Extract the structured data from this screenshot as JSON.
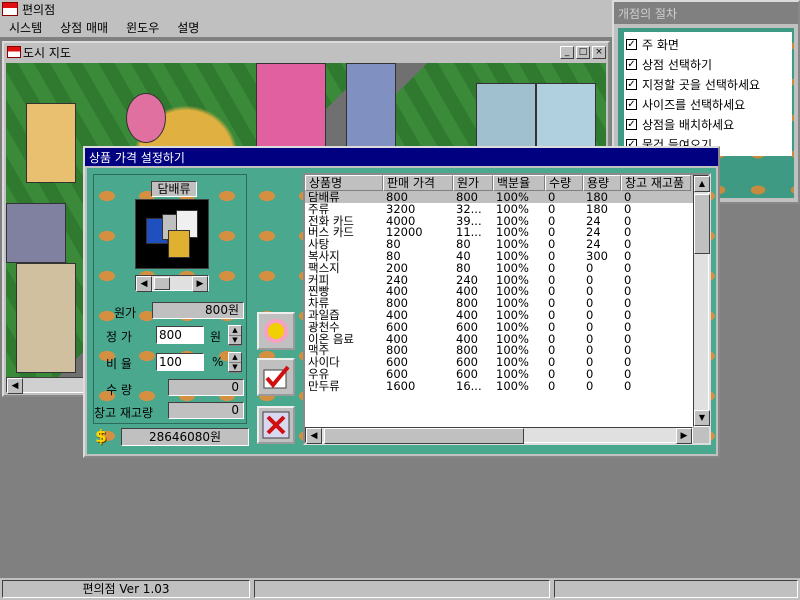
{
  "app": {
    "title": "편의점"
  },
  "menu": {
    "items": [
      "시스템",
      "상점 매매",
      "윈도우",
      "설명"
    ]
  },
  "map_window": {
    "title": "도시 지도"
  },
  "procedure": {
    "title": "개점의 절차",
    "steps": [
      {
        "label": "주 화면",
        "checked": true
      },
      {
        "label": "상점 선택하기",
        "checked": true
      },
      {
        "label": "지정할 곳을 선택하세요",
        "checked": true
      },
      {
        "label": "사이즈를 선택하세요",
        "checked": true
      },
      {
        "label": "상점을 배치하세요",
        "checked": true
      },
      {
        "label": "물건 들여오기",
        "checked": true
      }
    ]
  },
  "dialog": {
    "title": "상품 가격 설정하기",
    "product_name": "담배류",
    "cost_label": "원가",
    "cost_value": "800원",
    "price_label": "정 가",
    "price_value": "800",
    "price_unit": "원",
    "ratio_label": "비 율",
    "ratio_value": "100",
    "ratio_unit": "%",
    "qty_label": "수 량",
    "qty_value": "0",
    "stock_label": "창고 재고량",
    "stock_value": "0",
    "money_value": "28646080원",
    "money_icon": "dollar-icon",
    "buttons": {
      "auto": "sun-icon",
      "confirm": "check-icon",
      "cancel": "x-icon"
    }
  },
  "table": {
    "columns": [
      "상품명",
      "판매 가격",
      "원가",
      "백분율",
      "수량",
      "용량",
      "창고 재고품"
    ],
    "rows": [
      [
        "담배류",
        "800",
        "800",
        "100%",
        "0",
        "180",
        "0"
      ],
      [
        "주류",
        "3200",
        "32...",
        "100%",
        "0",
        "180",
        "0"
      ],
      [
        "전화 카드",
        "4000",
        "39...",
        "100%",
        "0",
        "24",
        "0"
      ],
      [
        "버스 카드",
        "12000",
        "11...",
        "100%",
        "0",
        "24",
        "0"
      ],
      [
        "사탕",
        "80",
        "80",
        "100%",
        "0",
        "24",
        "0"
      ],
      [
        "복사지",
        "80",
        "40",
        "100%",
        "0",
        "300",
        "0"
      ],
      [
        "팩스지",
        "200",
        "80",
        "100%",
        "0",
        "0",
        "0"
      ],
      [
        "커피",
        "240",
        "240",
        "100%",
        "0",
        "0",
        "0"
      ],
      [
        "찐빵",
        "400",
        "400",
        "100%",
        "0",
        "0",
        "0"
      ],
      [
        "차류",
        "800",
        "800",
        "100%",
        "0",
        "0",
        "0"
      ],
      [
        "과일즙",
        "400",
        "400",
        "100%",
        "0",
        "0",
        "0"
      ],
      [
        "광천수",
        "600",
        "600",
        "100%",
        "0",
        "0",
        "0"
      ],
      [
        "이온 음료",
        "400",
        "400",
        "100%",
        "0",
        "0",
        "0"
      ],
      [
        "맥주",
        "800",
        "800",
        "100%",
        "0",
        "0",
        "0"
      ],
      [
        "사이다",
        "600",
        "600",
        "100%",
        "0",
        "0",
        "0"
      ],
      [
        "우유",
        "600",
        "600",
        "100%",
        "0",
        "0",
        "0"
      ],
      [
        "만두류",
        "1600",
        "16...",
        "100%",
        "0",
        "0",
        "0"
      ]
    ],
    "selected_row": 0
  },
  "status": {
    "version": "편의점 Ver 1.03"
  },
  "colors": {
    "dialog_bg": "#4aa88e",
    "title_active": "#000080",
    "title_inactive": "#808080"
  }
}
